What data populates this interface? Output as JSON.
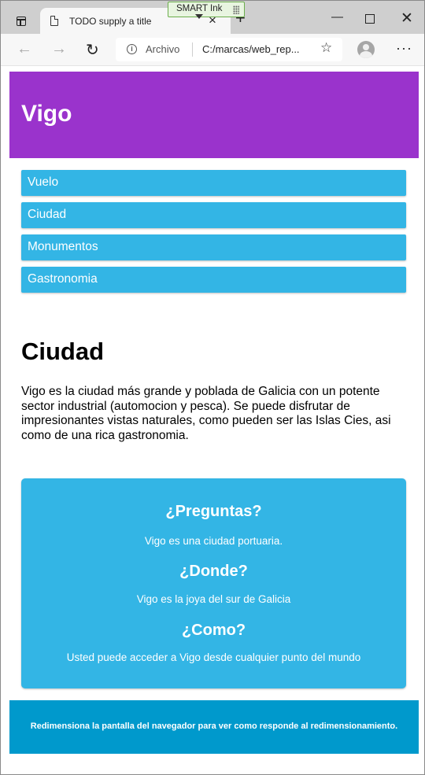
{
  "browser": {
    "tab_title": "TODO supply a title",
    "tab_close": "×",
    "new_tab": "+",
    "scheme_label": "Archivo",
    "url": "C:/marcas/web_rep...",
    "window_min": "—",
    "window_close": "✕",
    "nav_back": "←",
    "nav_forward": "→",
    "nav_reload": "↻",
    "favorite_icon": "☆",
    "menu_icon": "···"
  },
  "smart_ink": {
    "label": "SMART Ink"
  },
  "header": {
    "title": "Vigo"
  },
  "menu": {
    "items": [
      "Vuelo",
      "Ciudad",
      "Monumentos",
      "Gastronomia"
    ]
  },
  "main": {
    "title": "Ciudad",
    "text": "Vigo es la ciudad más grande y poblada de Galicia con un potente sector industrial (automocion y pesca). Se puede disfrutar de impresionantes vistas naturales, como pueden ser las Islas Cies, asi como de una rica gastronomia."
  },
  "aside": {
    "items": [
      {
        "heading": "¿Preguntas?",
        "text": "Vigo es una ciudad portuaria."
      },
      {
        "heading": "¿Donde?",
        "text": "Vigo es la joya del sur de Galicia"
      },
      {
        "heading": "¿Como?",
        "text": "Usted puede acceder a Vigo desde cualquier punto del mundo"
      }
    ]
  },
  "footer": {
    "text": "Redimensiona la pantalla del navegador para ver como responde al redimensionamiento."
  },
  "colors": {
    "header_bg": "#9a33cc",
    "menu_bg": "#33b5e5",
    "aside_bg": "#33b5e5",
    "footer_bg": "#0099cc"
  }
}
